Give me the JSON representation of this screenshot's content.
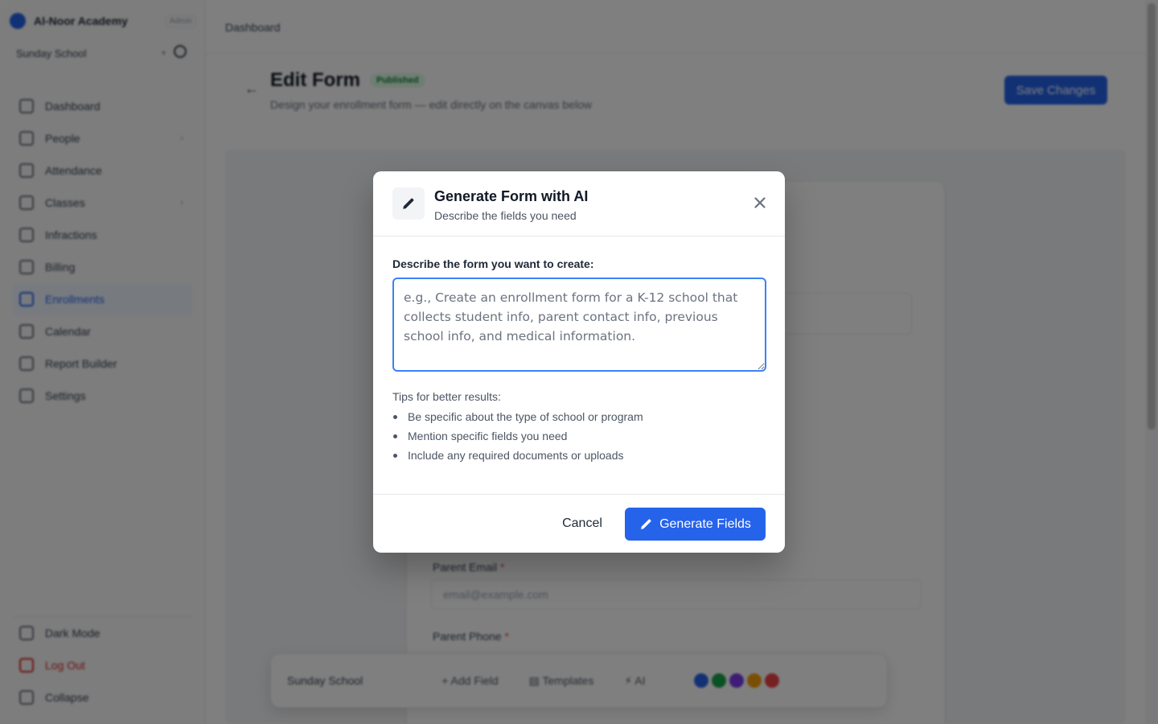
{
  "background": {
    "brand": {
      "name": "Al-Noor Academy",
      "badge": "Admin"
    },
    "school_switcher": "Sunday School",
    "nav": [
      {
        "label": "Dashboard",
        "icon": "home-icon",
        "chevron": false,
        "active": false
      },
      {
        "label": "People",
        "icon": "users-icon",
        "chevron": true,
        "active": false
      },
      {
        "label": "Attendance",
        "icon": "clipboard-icon",
        "chevron": false,
        "active": false
      },
      {
        "label": "Classes",
        "icon": "book-icon",
        "chevron": true,
        "active": false
      },
      {
        "label": "Infractions",
        "icon": "alert-icon",
        "chevron": false,
        "active": false
      },
      {
        "label": "Billing",
        "icon": "credit-card-icon",
        "chevron": false,
        "active": false
      },
      {
        "label": "Enrollments",
        "icon": "user-plus-icon",
        "chevron": false,
        "active": true
      },
      {
        "label": "Calendar",
        "icon": "calendar-icon",
        "chevron": false,
        "active": false
      },
      {
        "label": "Report Builder",
        "icon": "file-chart-icon",
        "chevron": false,
        "active": false
      },
      {
        "label": "Settings",
        "icon": "gear-icon",
        "chevron": false,
        "active": false
      }
    ],
    "bottom_nav": [
      {
        "label": "Dark Mode",
        "icon": "moon-icon"
      },
      {
        "label": "Log Out",
        "icon": "logout-icon"
      },
      {
        "label": "Collapse",
        "icon": "collapse-icon"
      }
    ],
    "breadcrumb": "Dashboard",
    "page_title": "Edit Form",
    "status_badge": "Published",
    "page_subtitle": "Design your enrollment form — edit directly on the canvas below",
    "save_button": "Save Changes",
    "fields": [
      {
        "label": "Parent Email",
        "placeholder": "email@example.com"
      },
      {
        "label": "Parent Phone",
        "placeholder": ""
      }
    ],
    "bottom_bar": {
      "form_name": "Sunday School",
      "add_field": "Add Field",
      "templates": "Templates",
      "ai": "AI",
      "theme_colors": [
        "#2563eb",
        "#16a34a",
        "#7c3aed",
        "#f59e0b",
        "#ef4444"
      ]
    }
  },
  "modal": {
    "title": "Generate Form with AI",
    "subtitle": "Describe the fields you need",
    "prompt_label": "Describe the form you want to create:",
    "prompt_placeholder": "e.g., Create an enrollment form for a K-12 school that collects student info, parent contact info, previous school info, and medical information.",
    "prompt_value": "",
    "tips_title": "Tips for better results:",
    "tips": [
      "Be specific about the type of school or program",
      "Mention specific fields you need",
      "Include any required documents or uploads"
    ],
    "cancel_label": "Cancel",
    "generate_label": "Generate Fields",
    "accent_color": "#2563eb"
  }
}
